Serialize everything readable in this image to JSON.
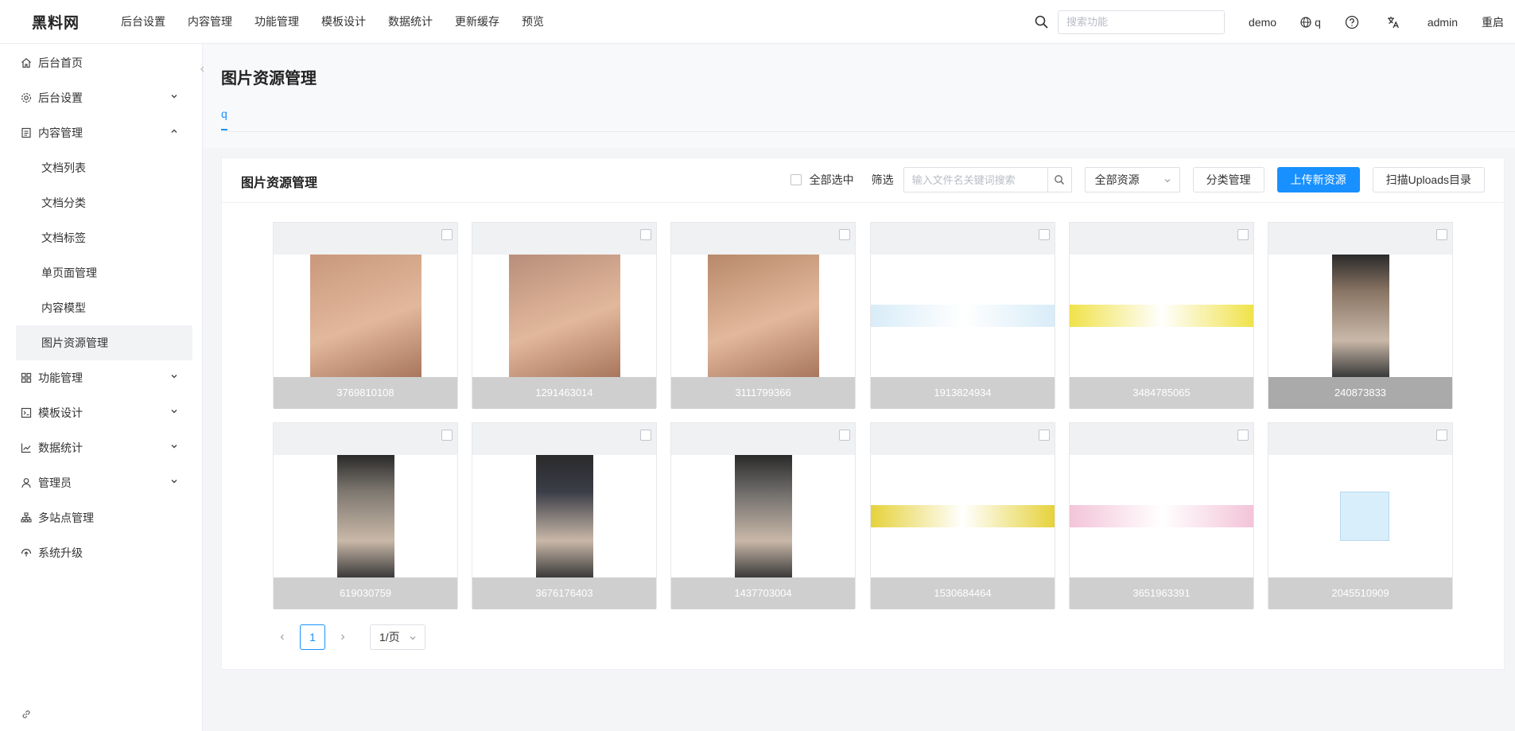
{
  "app": {
    "logo": "黑料网",
    "topnav": [
      "后台设置",
      "内容管理",
      "功能管理",
      "模板设计",
      "数据统计",
      "更新缓存",
      "预览"
    ],
    "search_placeholder": "搜索功能",
    "site": "demo",
    "lang": "q",
    "user": "admin",
    "restart": "重启",
    "icons": {
      "search": "search-icon",
      "globe": "globe-icon",
      "help": "help-icon",
      "translate": "translate-icon"
    }
  },
  "sidebar": {
    "items": [
      {
        "label": "后台首页",
        "icon": "home-icon"
      },
      {
        "label": "后台设置",
        "icon": "gear-icon",
        "expandable": true
      },
      {
        "label": "内容管理",
        "icon": "document-icon",
        "expandable": true,
        "expanded": true
      },
      {
        "label": "功能管理",
        "icon": "grid-icon",
        "expandable": true
      },
      {
        "label": "模板设计",
        "icon": "template-icon",
        "expandable": true
      },
      {
        "label": "数据统计",
        "icon": "chart-icon",
        "expandable": true
      },
      {
        "label": "管理员",
        "icon": "user-icon",
        "expandable": true
      },
      {
        "label": "多站点管理",
        "icon": "sitemap-icon"
      },
      {
        "label": "系统升级",
        "icon": "upgrade-icon"
      }
    ],
    "sub_items": [
      "文档列表",
      "文档分类",
      "文档标签",
      "单页面管理",
      "内容模型",
      "图片资源管理"
    ],
    "active_sub": "图片资源管理"
  },
  "page": {
    "title": "图片资源管理",
    "tab": "q"
  },
  "card": {
    "title": "图片资源管理",
    "select_all": "全部选中",
    "filter_label": "筛选",
    "filter_placeholder": "输入文件名关键词搜索",
    "resource_select": "全部资源",
    "btn_category": "分类管理",
    "btn_upload": "上传新资源",
    "btn_scan": "扫描Uploads目录"
  },
  "images": [
    {
      "name": "3769810108",
      "kind": "photo",
      "color": "#c9987c"
    },
    {
      "name": "1291463014",
      "kind": "photo",
      "color": "#b98e7a"
    },
    {
      "name": "3111799366",
      "kind": "photo",
      "color": "#b8896a"
    },
    {
      "name": "1913824934",
      "kind": "banner",
      "color": "#d8ecf8"
    },
    {
      "name": "3484785065",
      "kind": "banner",
      "color": "#f0e24a"
    },
    {
      "name": "240873833",
      "kind": "tall",
      "color": "#8a7564",
      "selected": true
    },
    {
      "name": "619030759",
      "kind": "tall",
      "color": "#7e7870"
    },
    {
      "name": "3676176403",
      "kind": "tall",
      "color": "#3b3d48"
    },
    {
      "name": "1437703004",
      "kind": "tall",
      "color": "#6e6c6a"
    },
    {
      "name": "1530684464",
      "kind": "banner",
      "color": "#e6d23c"
    },
    {
      "name": "3651963391",
      "kind": "banner",
      "color": "#f3c4d8"
    },
    {
      "name": "2045510909",
      "kind": "logo",
      "color": "#d8eefb"
    }
  ],
  "pagination": {
    "current": "1",
    "page_size": "1/页"
  }
}
